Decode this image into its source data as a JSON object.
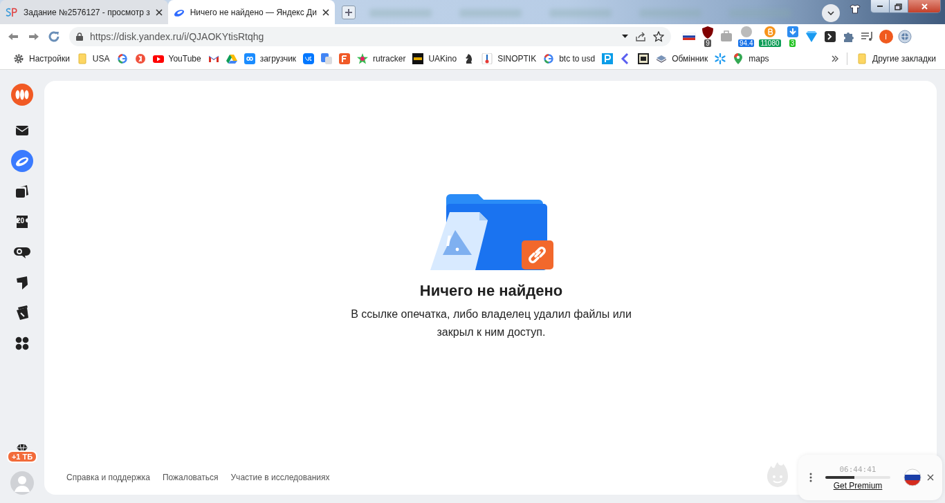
{
  "tabs": [
    {
      "kind": "sp",
      "title": "Задание №2576127 - просмотр з",
      "selected": false
    },
    {
      "kind": "disk",
      "title": "Ничего не найдено — Яндекс Ди",
      "selected": true
    }
  ],
  "address_bar": {
    "url": "https://disk.yandex.ru/i/QJAOKYtisRtqhg"
  },
  "extensions": [
    {
      "kind": "flag"
    },
    {
      "kind": "shield",
      "badge": "9",
      "color": "#555555"
    },
    {
      "kind": "case"
    },
    {
      "kind": "coin",
      "badge": "94.4",
      "color": "#1a73e8"
    },
    {
      "kind": "bitcoin",
      "badge": "11080",
      "color": "#0f9d58"
    },
    {
      "kind": "download",
      "badge": "3",
      "color": "#22c322"
    },
    {
      "kind": "diamond"
    },
    {
      "kind": "terminal"
    },
    {
      "kind": "puzzle"
    },
    {
      "kind": "music"
    },
    {
      "kind": "profile",
      "badge": "I",
      "color": "#f05a1e"
    },
    {
      "kind": "globe"
    }
  ],
  "bookmarks": [
    {
      "kind": "gear",
      "label": "Настройки"
    },
    {
      "kind": "folder",
      "label": "USA"
    },
    {
      "kind": "google"
    },
    {
      "kind": "yandex"
    },
    {
      "kind": "youtube",
      "label": "YouTube"
    },
    {
      "kind": "gmail"
    },
    {
      "kind": "drive"
    },
    {
      "kind": "infinity",
      "label": "загрузчик"
    },
    {
      "kind": "vk"
    },
    {
      "kind": "translate"
    },
    {
      "kind": "square_orange"
    },
    {
      "kind": "star",
      "label": "rutracker"
    },
    {
      "kind": "film",
      "label": "UAKino"
    },
    {
      "kind": "knight"
    },
    {
      "kind": "thermo",
      "label": "SINOPTIK"
    },
    {
      "kind": "google",
      "label": "btc to usd"
    },
    {
      "kind": "square_blue"
    },
    {
      "kind": "chevron"
    },
    {
      "kind": "square_dark"
    },
    {
      "kind": "layers",
      "label": "Обмінник"
    },
    {
      "kind": "asterisk"
    },
    {
      "kind": "pin",
      "label": "maps"
    }
  ],
  "other_bookmarks": "Другие закладки",
  "sidebar": {
    "items": [
      {
        "kind": "mail",
        "selected": false
      },
      {
        "kind": "disk",
        "selected": true
      },
      {
        "kind": "docs",
        "selected": false
      },
      {
        "kind": "calendar",
        "text": "20",
        "selected": false
      },
      {
        "kind": "messenger",
        "selected": false
      },
      {
        "kind": "notes",
        "selected": false
      },
      {
        "kind": "clip",
        "selected": false
      },
      {
        "kind": "apps",
        "selected": false
      }
    ],
    "storage_badge": "+1 ТБ"
  },
  "empty_state": {
    "title": "Ничего не найдено",
    "message": "В ссылке опечатка, либо владелец удалил файлы или закрыл к ним доступ."
  },
  "footer_links": [
    "Справка и поддержка",
    "Пожаловаться",
    "Участие в исследованиях"
  ],
  "vpn_widget": {
    "timer": "06:44:41",
    "level": 0.45,
    "link": "Get Premium"
  }
}
